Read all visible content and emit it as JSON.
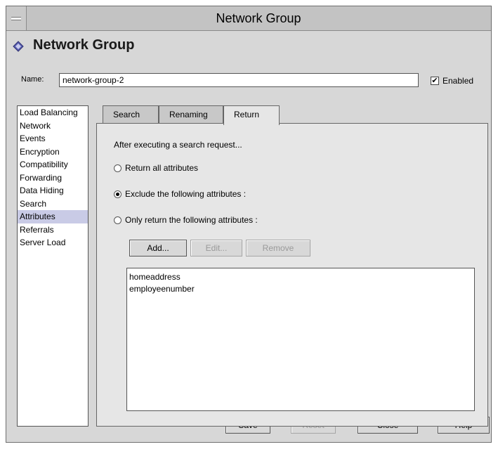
{
  "window": {
    "title": "Network Group"
  },
  "header": {
    "title": "Network Group",
    "icon": "diamond-icon"
  },
  "name": {
    "label": "Name:",
    "value": "network-group-2"
  },
  "enabled": {
    "label": "Enabled",
    "checked": true
  },
  "sidebar": {
    "items": [
      {
        "label": "Load Balancing"
      },
      {
        "label": "Network"
      },
      {
        "label": "Events"
      },
      {
        "label": "Encryption"
      },
      {
        "label": "Compatibility"
      },
      {
        "label": "Forwarding"
      },
      {
        "label": "Data Hiding"
      },
      {
        "label": "Search"
      },
      {
        "label": "Attributes"
      },
      {
        "label": "Referrals"
      },
      {
        "label": "Server Load"
      }
    ],
    "selected": "Attributes"
  },
  "tabs": [
    {
      "label": "Search"
    },
    {
      "label": "Renaming"
    },
    {
      "label": "Return"
    }
  ],
  "active_tab": "Return",
  "panel": {
    "intro": "After executing a search request...",
    "options": [
      {
        "label": "Return all attributes",
        "selected": false
      },
      {
        "label": "Exclude the following attributes :",
        "selected": true
      },
      {
        "label": "Only return the following attributes :",
        "selected": false
      }
    ],
    "buttons": {
      "add": "Add...",
      "edit": "Edit...",
      "remove": "Remove"
    },
    "attributes": [
      "homeaddress",
      "employeenumber"
    ]
  },
  "footer": {
    "save": "Save",
    "reset": "Reset",
    "close": "Close",
    "help": "Help"
  }
}
